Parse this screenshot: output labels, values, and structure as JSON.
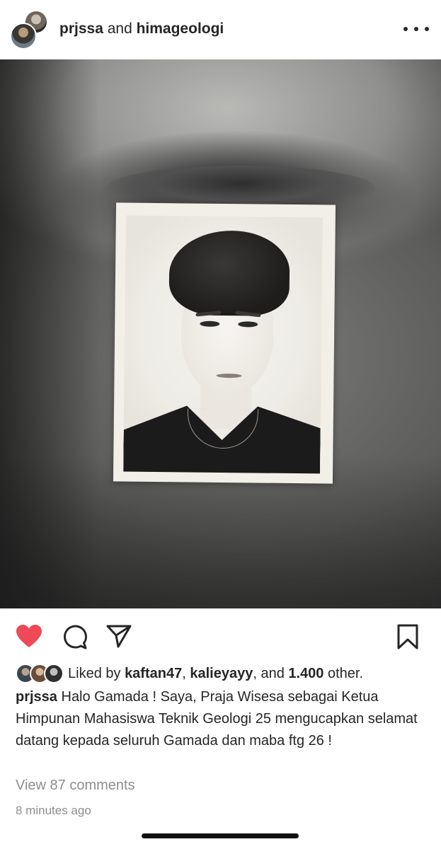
{
  "header": {
    "username_1": "prjssa",
    "connector": " and ",
    "username_2": "himageologi",
    "more_icon": "more-horizontal-icon"
  },
  "post": {
    "image_alt": "black-and-white photo of a passport-style portrait held in front of a face",
    "liked": true
  },
  "actions": {
    "like_icon": "heart-filled-icon",
    "comment_icon": "comment-icon",
    "share_icon": "paper-plane-icon",
    "save_icon": "bookmark-icon",
    "like_color": "#ed4956"
  },
  "likes": {
    "prefix": "Liked by ",
    "user_1": "kaftan47",
    "sep": ", ",
    "user_2": "kalieyayy",
    "and": ", and ",
    "count": "1.400",
    "suffix": " other."
  },
  "caption": {
    "username": "prjssa",
    "text": " Halo Gamada ! Saya, Praja Wisesa sebagai Ketua Himpunan Mahasiswa Teknik Geologi 25 mengucapkan selamat datang kepada seluruh Gamada dan maba ftg 26 !"
  },
  "comments": {
    "view_label": "View 87 comments"
  },
  "timestamp": "8 minutes ago"
}
